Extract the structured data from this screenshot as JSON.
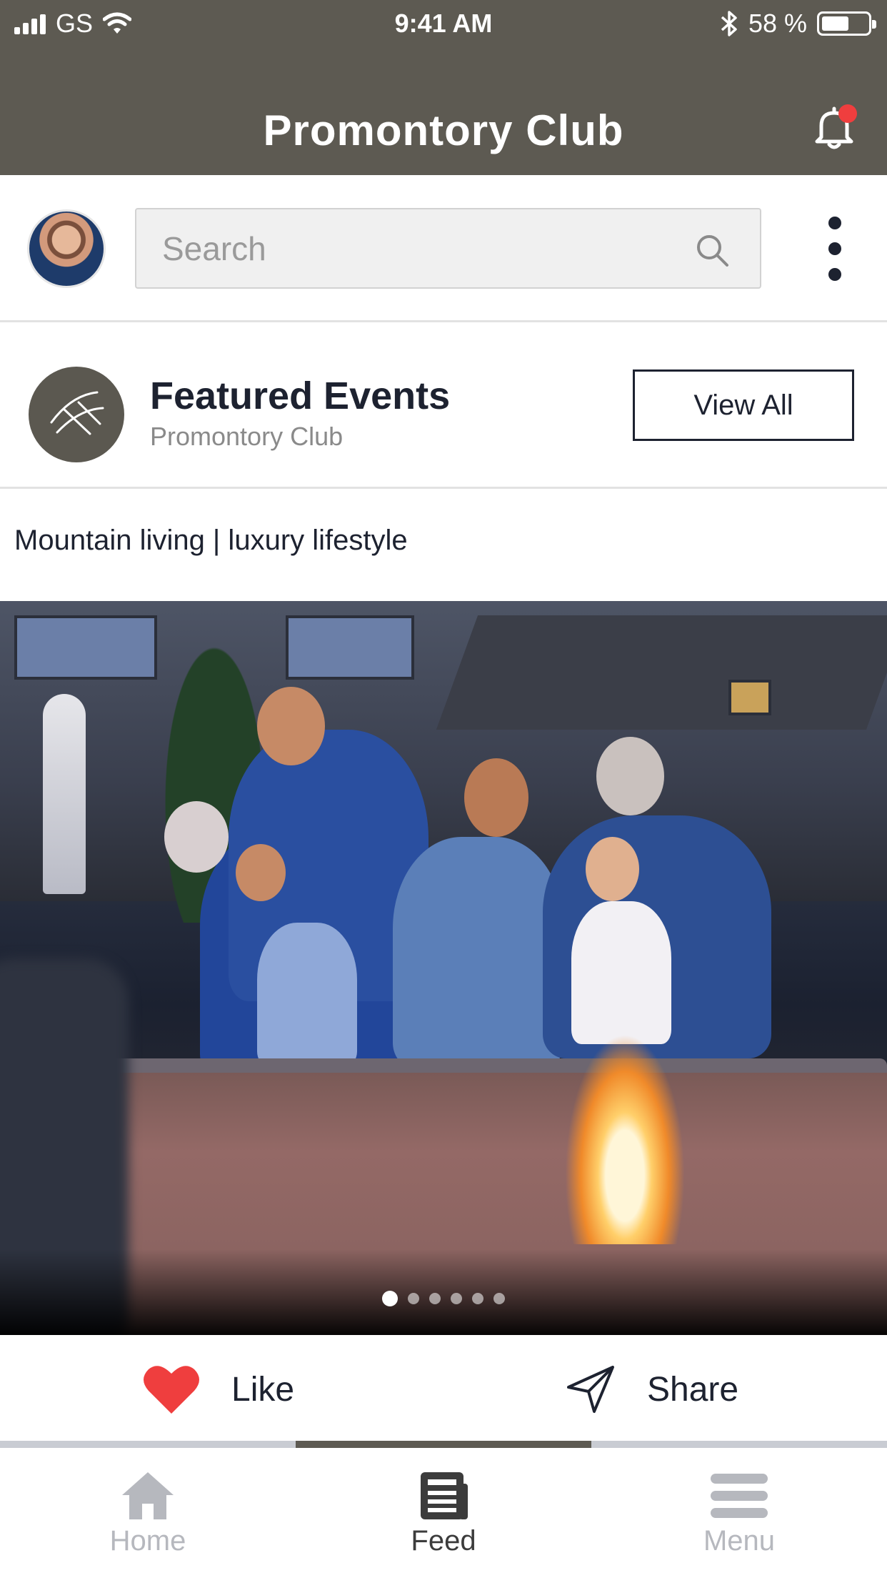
{
  "status_bar": {
    "carrier": "GS",
    "time": "9:41 AM",
    "battery": "58 %",
    "battery_level": 0.58,
    "icons": [
      "signal-icon",
      "wifi-icon",
      "bluetooth-icon",
      "battery-icon"
    ]
  },
  "nav": {
    "title": "Promontory Club",
    "notification_icon": "bell-icon",
    "has_notification": true
  },
  "search": {
    "placeholder": "Search",
    "value": "",
    "icon": "search-icon"
  },
  "menu_icon": "more-vertical-icon",
  "featured": {
    "title": "Featured Events",
    "subtitle": "Promontory Club",
    "view_all_label": "View All"
  },
  "post": {
    "caption": "Mountain living | luxury lifestyle",
    "carousel": {
      "total": 6,
      "active": 0
    }
  },
  "actions": {
    "like_label": "Like",
    "share_label": "Share",
    "like_icon": "heart-icon",
    "share_icon": "send-icon"
  },
  "tabs": [
    {
      "label": "Home",
      "icon": "home-icon",
      "active": false
    },
    {
      "label": "Feed",
      "icon": "newspaper-icon",
      "active": true
    },
    {
      "label": "Menu",
      "icon": "menu-icon",
      "active": false
    }
  ],
  "colors": {
    "header": "#5d5a52",
    "accent_red": "#ef3e3e",
    "text_dark": "#1d2230",
    "tab_inactive": "#b6b8be"
  }
}
